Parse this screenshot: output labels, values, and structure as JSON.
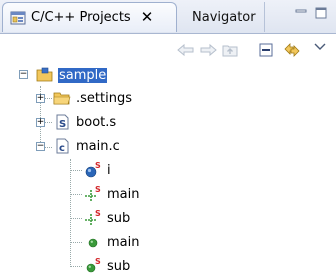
{
  "view": {
    "tabs": [
      {
        "label": "C/C++ Projects",
        "active": true
      },
      {
        "label": "Navigator",
        "active": false
      }
    ],
    "close_glyph": "✕"
  },
  "toolbar": {
    "buttons": [
      {
        "icon": "back-arrow-icon",
        "enabled": false
      },
      {
        "icon": "forward-arrow-icon",
        "enabled": false
      },
      {
        "icon": "up-folder-icon",
        "enabled": false
      },
      {
        "icon": "collapse-all-icon",
        "enabled": true
      },
      {
        "icon": "link-with-editor-icon",
        "enabled": true
      },
      {
        "icon": "view-menu-chevron-icon",
        "enabled": true
      }
    ]
  },
  "tree": {
    "project": {
      "label": "sample",
      "icon": "project-folder-icon",
      "expanded": true,
      "selected": true
    },
    "children": [
      {
        "label": ".settings",
        "icon": "folder-icon",
        "expanded": false
      },
      {
        "label": "boot.s",
        "icon": "asm-file-icon",
        "expanded": false
      },
      {
        "label": "main.c",
        "icon": "c-source-file-icon",
        "expanded": true,
        "members": [
          {
            "label": "i",
            "icon": "static-variable-icon"
          },
          {
            "label": "main",
            "icon": "static-function-declaration-icon"
          },
          {
            "label": "sub",
            "icon": "static-function-declaration-icon"
          },
          {
            "label": "main",
            "icon": "function-icon"
          },
          {
            "label": "sub",
            "icon": "static-function-icon"
          }
        ]
      }
    ]
  },
  "colors": {
    "selection": "#3169c6",
    "folder": "#f2c75c",
    "function": "#3a9a3a",
    "variable": "#2a66b8",
    "static_badge": "#d3272a"
  }
}
